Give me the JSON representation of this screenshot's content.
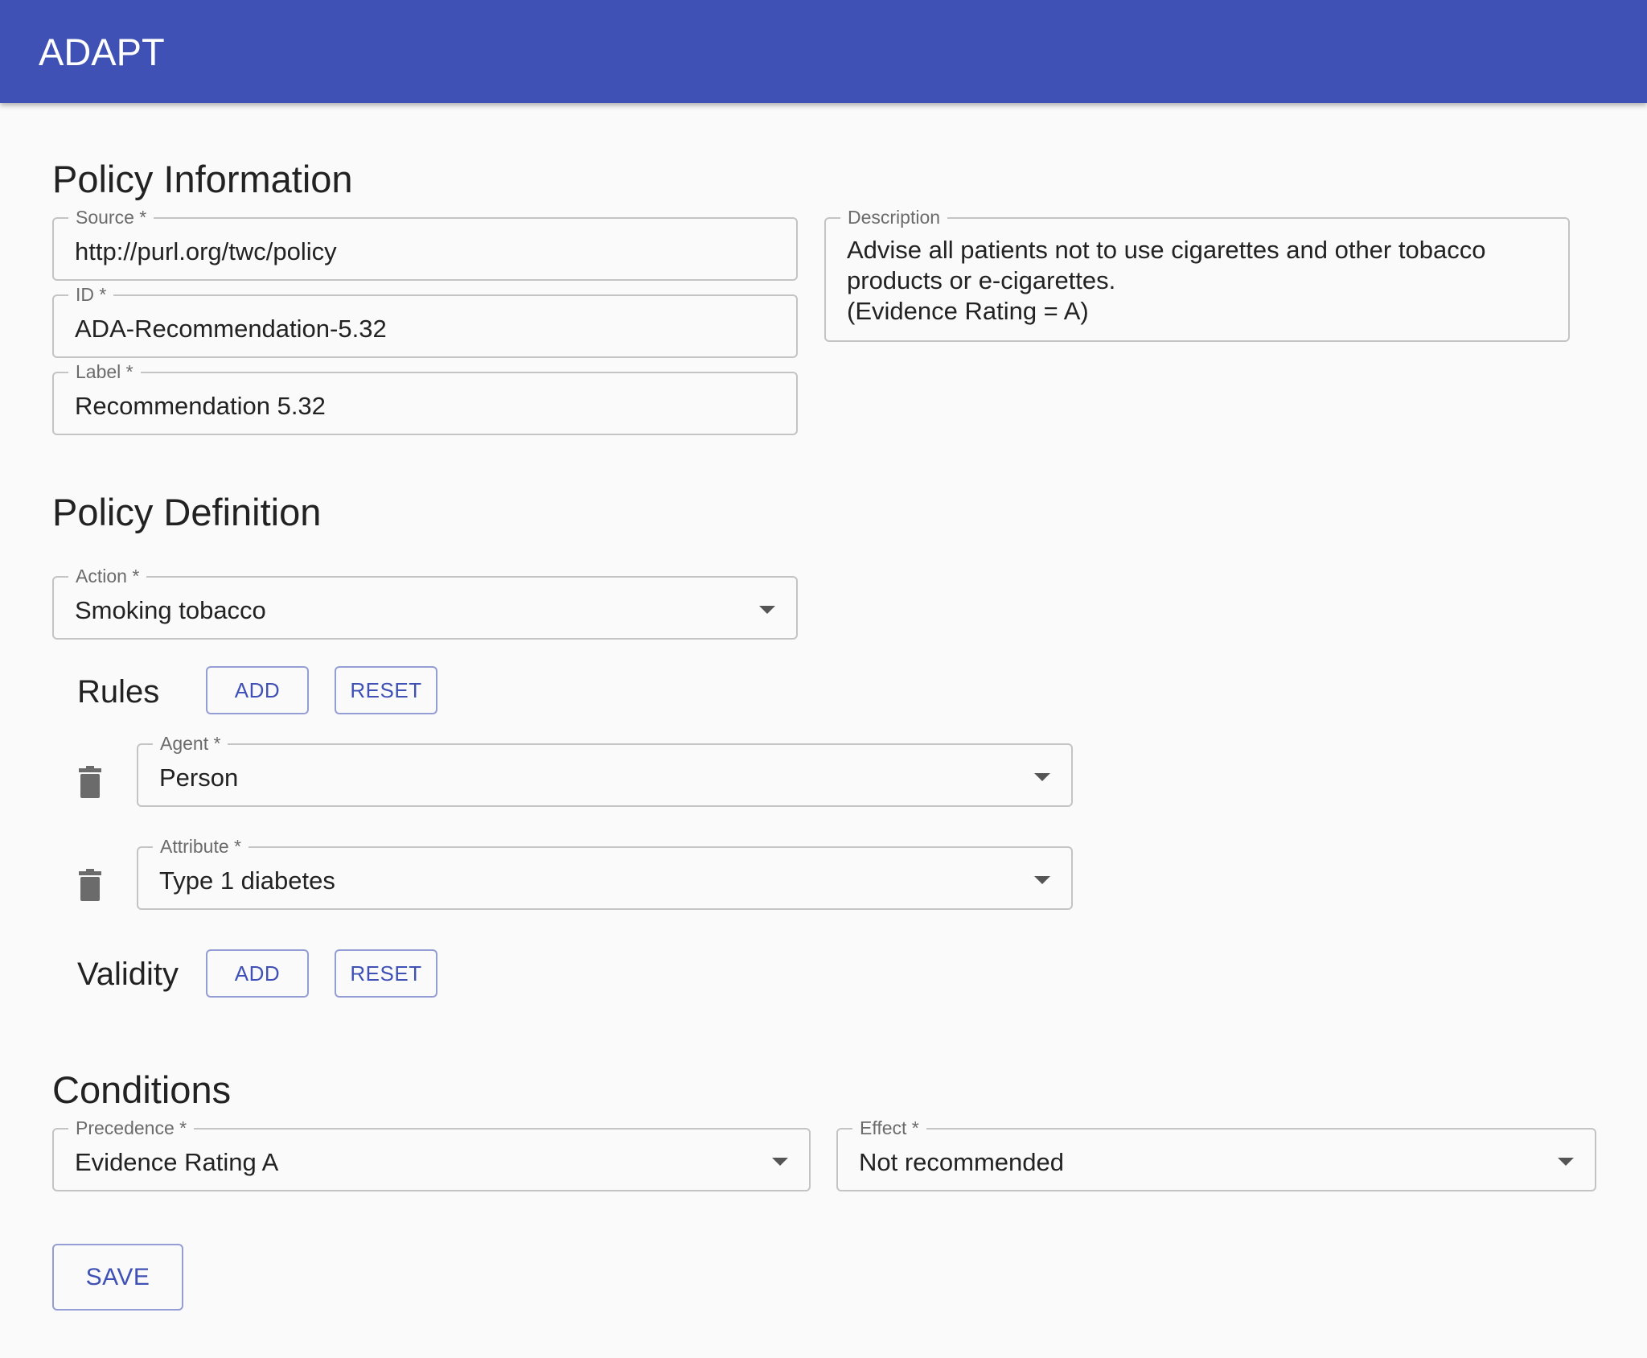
{
  "app": {
    "title": "ADAPT"
  },
  "policy_information": {
    "title": "Policy Information",
    "source": {
      "label": "Source *",
      "value": "http://purl.org/twc/policy"
    },
    "id": {
      "label": "ID *",
      "value": "ADA-Recommendation-5.32"
    },
    "label_field": {
      "label": "Label *",
      "value": "Recommendation 5.32"
    },
    "description": {
      "label": "Description",
      "lines": [
        "Advise all patients not to use cigarettes and other tobacco",
        "products or e-cigarettes.",
        "(Evidence Rating = A)"
      ]
    }
  },
  "policy_definition": {
    "title": "Policy Definition",
    "action": {
      "label": "Action *",
      "value": "Smoking tobacco"
    },
    "rules": {
      "title": "Rules",
      "add_label": "ADD",
      "reset_label": "RESET",
      "items": [
        {
          "label": "Agent *",
          "value": "Person"
        },
        {
          "label": "Attribute *",
          "value": "Type 1 diabetes"
        }
      ]
    },
    "validity": {
      "title": "Validity",
      "add_label": "ADD",
      "reset_label": "RESET"
    }
  },
  "conditions": {
    "title": "Conditions",
    "precedence": {
      "label": "Precedence *",
      "value": "Evidence Rating A"
    },
    "effect": {
      "label": "Effect *",
      "value": "Not recommended"
    }
  },
  "save_label": "SAVE",
  "icons": {
    "caret": "dropdown-arrow-icon",
    "delete": "trash-icon"
  },
  "colors": {
    "primary": "#3f51b5",
    "background": "#fafafa",
    "outline": "#c4c4c4"
  }
}
